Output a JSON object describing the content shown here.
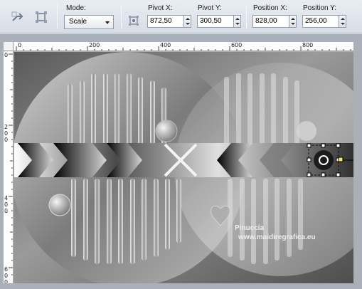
{
  "toolbar": {
    "mode_label": "Mode:",
    "mode_value": "Scale",
    "pivot_x_label": "Pivot X:",
    "pivot_x_value": "872,50",
    "pivot_y_label": "Pivot Y:",
    "pivot_y_value": "300,50",
    "position_x_label": "Position X:",
    "position_x_value": "828,00",
    "position_y_label": "Position Y:",
    "position_y_value": "256,00"
  },
  "ruler": {
    "top_marks": [
      "0",
      "200",
      "400",
      "600",
      "800"
    ],
    "left_marks": [
      "0",
      "2",
      "0",
      "0",
      "4",
      "0",
      "0",
      "6",
      "0",
      "0"
    ]
  },
  "watermark": {
    "name": "Pinuccia",
    "url": "www.maidiregrafica.eu"
  }
}
